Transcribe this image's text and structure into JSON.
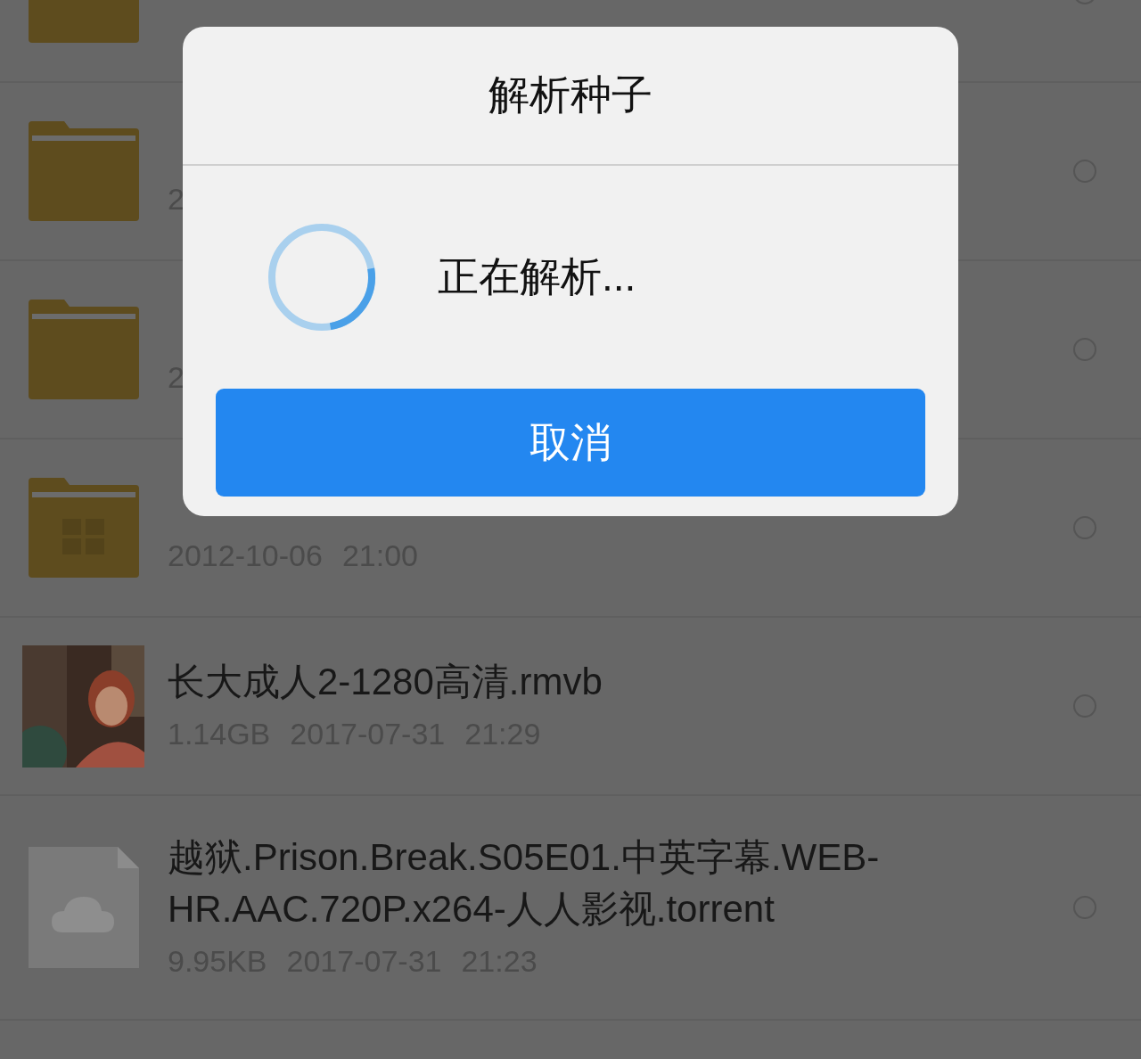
{
  "files": [
    {
      "kind": "folder",
      "selected": false
    },
    {
      "kind": "folder",
      "meta": [
        "2"
      ],
      "selected": false
    },
    {
      "kind": "folder",
      "meta": [
        "2"
      ],
      "selected": false
    },
    {
      "kind": "app-folder",
      "meta": [
        "2012-10-06",
        "21:00"
      ],
      "selected": false
    },
    {
      "kind": "video",
      "name": "长大成人2-1280高清.rmvb",
      "meta": [
        "1.14GB",
        "2017-07-31",
        "21:29"
      ],
      "selected": false
    },
    {
      "kind": "torrent",
      "name": "越狱.Prison.Break.S05E01.中英字幕.WEB-HR.AAC.720P.x264-人人影视.torrent",
      "meta": [
        "9.95KB",
        "2017-07-31",
        "21:23"
      ],
      "selected": false
    }
  ],
  "dialog": {
    "title": "解析种子",
    "message": "正在解析...",
    "cancel_button": "取消"
  }
}
